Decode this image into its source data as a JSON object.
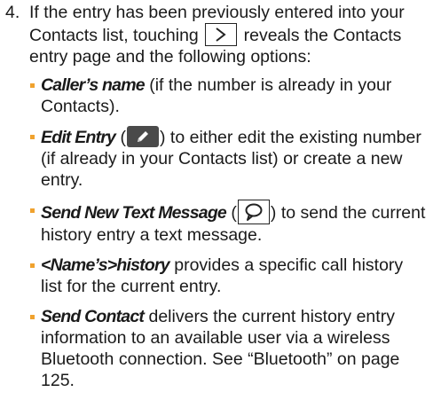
{
  "step": {
    "number": "4.",
    "intro_before_icon": "If the entry has been previously entered into your Contacts list, touching",
    "intro_after_icon": "reveals the Contacts entry page and the following options:",
    "chevron_icon": "chevron-right-icon"
  },
  "options": [
    {
      "term": "Caller’s name",
      "desc": " (if the number is already in your Contacts)."
    },
    {
      "term": "Edit Entry",
      "desc_before_icon": " (",
      "icon": "pencil-icon",
      "desc": ") to either edit the existing number (if already in your Contacts list) or create a new entry."
    },
    {
      "term": "Send New Text Message",
      "desc_before_icon": " (",
      "icon": "speech-bubble-icon",
      "desc": ") to send the current history entry a text message."
    },
    {
      "term": "<Name’s>history",
      "desc": " provides a specific call history list for the current entry."
    },
    {
      "term": "Send Contact",
      "desc": " delivers the current history entry information to an available user via a wireless Bluetooth connection. See “Bluetooth” on page 125."
    }
  ],
  "colors": {
    "bullet": "#f0a22e",
    "text": "#1a1a1a",
    "edit_icon_bg": "#4a4a4a"
  }
}
